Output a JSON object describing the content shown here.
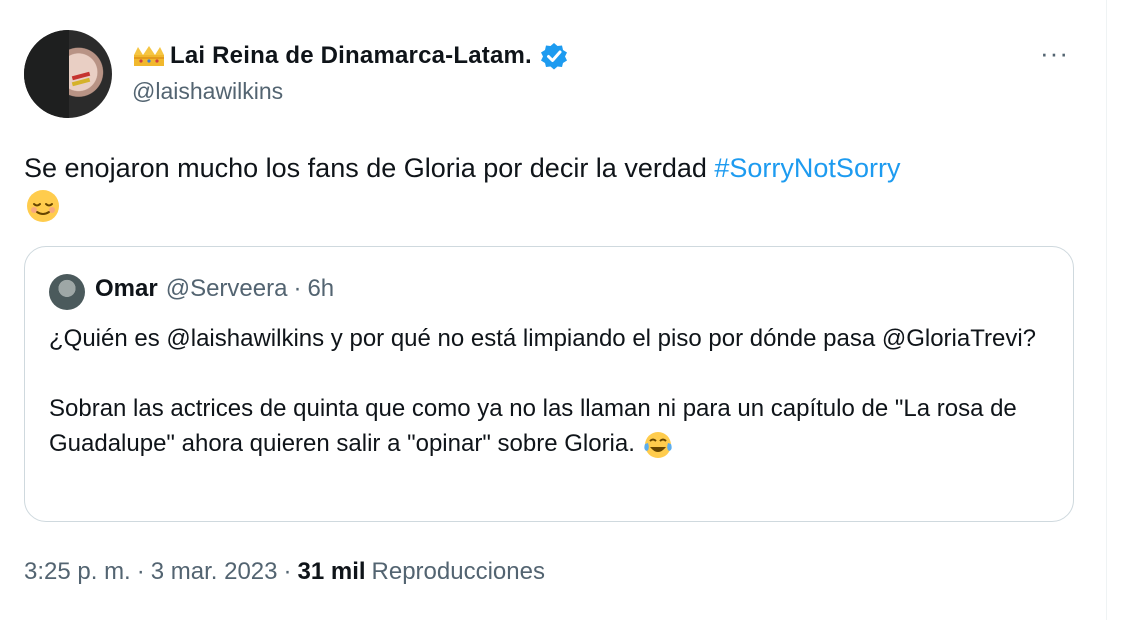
{
  "author": {
    "display_name": "Lai Reina de Dinamarca-Latam.",
    "handle": "@laishawilkins",
    "crown_icon": "crown-icon",
    "verified_icon": "verified-badge-icon"
  },
  "tweet": {
    "text": "Se enojaron mucho los fans de Gloria por decir la verdad ",
    "hashtag": "#SorryNotSorry",
    "emoji": "relieved-face-emoji"
  },
  "quote": {
    "name": "Omar",
    "handle": "@Serveera",
    "separator": "·",
    "time": "6h",
    "line1": "¿Quién es @laishawilkins y por qué no está limpiando el piso por dónde pasa @GloriaTrevi?",
    "line2": "Sobran las actrices de quinta que como ya no las llaman ni para un capítulo de \"La rosa de Guadalupe\" ahora quieren salir a \"opinar\" sobre Gloria. ",
    "emoji": "tears-of-joy-emoji"
  },
  "footer": {
    "time": "3:25 p. m.",
    "separator": "·",
    "date": "3 mar. 2023",
    "views_count": "31 mil",
    "views_label": "Reproducciones"
  },
  "menu": {
    "more": "···"
  },
  "colors": {
    "accent": "#1d9bf0",
    "secondary_text": "#536471",
    "border": "#cfd9de"
  }
}
